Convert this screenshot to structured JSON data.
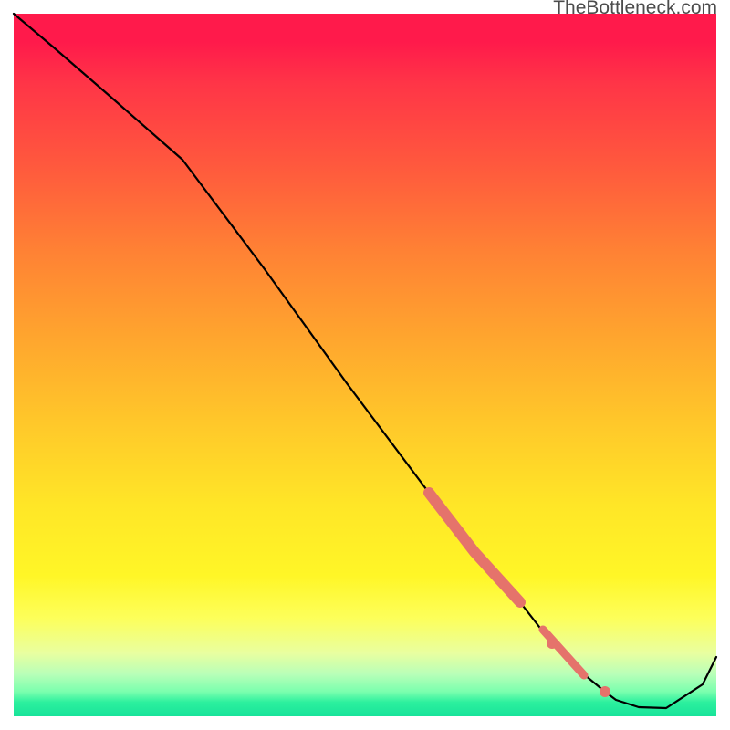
{
  "watermark": "TheBottleneck.com",
  "chart_data": {
    "type": "line",
    "x": [
      15,
      60,
      120,
      200,
      290,
      380,
      470,
      520,
      570,
      605,
      635,
      663,
      675,
      700,
      730,
      770,
      785
    ],
    "values": [
      15,
      53,
      105,
      175,
      295,
      420,
      540,
      605,
      660,
      705,
      735,
      758,
      767,
      775,
      776,
      750,
      720
    ],
    "title": "",
    "xlabel": "",
    "ylabel": "",
    "xlim": [
      15,
      785
    ],
    "ylim": [
      15,
      785
    ],
    "highlighted_points": [
      {
        "x": 605,
        "y": 705
      },
      {
        "x": 663,
        "y": 758
      }
    ],
    "highlighted_segment": [
      {
        "x1": 470,
        "y1": 540,
        "x2": 570,
        "y2": 660
      },
      {
        "x1": 595,
        "y1": 690,
        "x2": 640,
        "y2": 740
      }
    ],
    "highlight_color": "#e5736b",
    "line_color": "#000000"
  }
}
